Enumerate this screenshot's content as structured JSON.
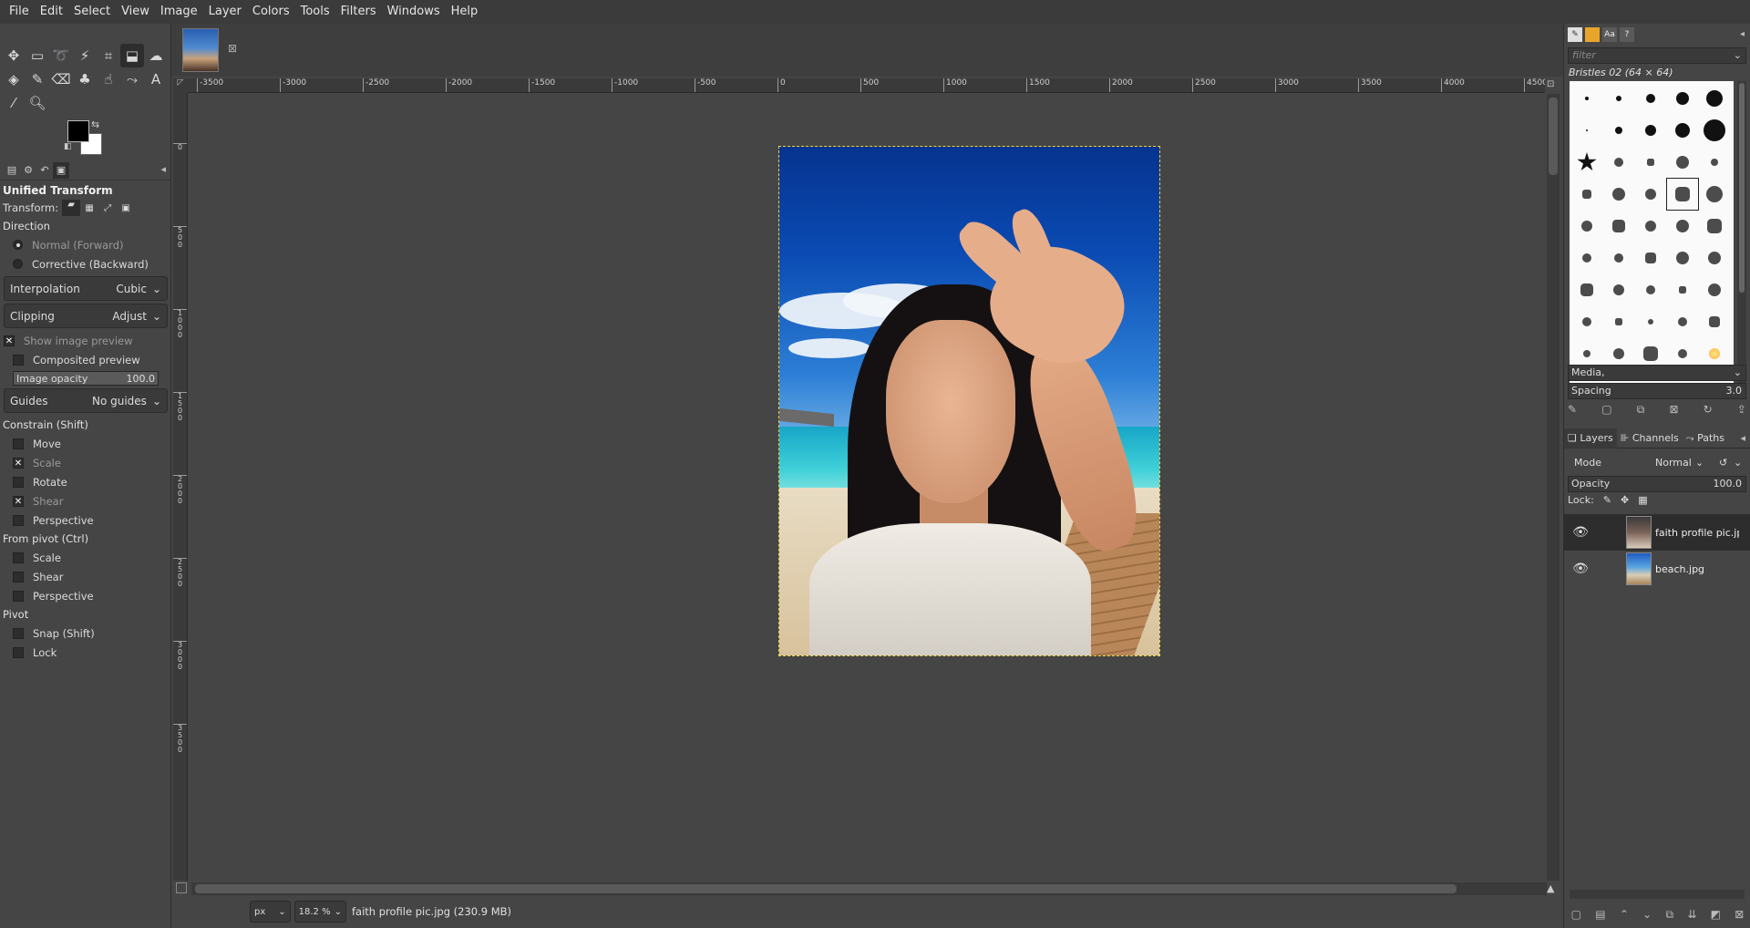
{
  "menubar": {
    "items": [
      "File",
      "Edit",
      "Select",
      "View",
      "Image",
      "Layer",
      "Colors",
      "Tools",
      "Filters",
      "Windows",
      "Help"
    ]
  },
  "tool_options": {
    "title": "Unified Transform",
    "transform_label": "Transform:",
    "direction_label": "Direction",
    "direction_forward": "Normal (Forward)",
    "direction_backward": "Corrective (Backward)",
    "interpolation_label": "Interpolation",
    "interpolation_value": "Cubic",
    "clipping_label": "Clipping",
    "clipping_value": "Adjust",
    "show_preview": "Show image preview",
    "composited_preview": "Composited preview",
    "opacity_label": "Image opacity",
    "opacity_value": "100.0",
    "guides_label": "Guides",
    "guides_value": "No guides",
    "constrain_label": "Constrain (Shift)",
    "constrain_move": "Move",
    "constrain_scale": "Scale",
    "constrain_rotate": "Rotate",
    "constrain_shear": "Shear",
    "constrain_perspective": "Perspective",
    "pivot_label": "From pivot  (Ctrl)",
    "pivot_scale": "Scale",
    "pivot_shear": "Shear",
    "pivot_perspective": "Perspective",
    "pivot_section": "Pivot",
    "snap": "Snap (Shift)",
    "lock": "Lock"
  },
  "rulers": {
    "h_labels": [
      "-3500",
      "-3000",
      "-2500",
      "-2000",
      "-1500",
      "-1000",
      "-500",
      "0",
      "500",
      "1000",
      "1500",
      "2000",
      "2500",
      "3000",
      "3500",
      "4000",
      "4500"
    ],
    "v_labels": [
      "0",
      "500",
      "1000",
      "1500",
      "2000",
      "2500",
      "3000",
      "3500"
    ]
  },
  "brushes": {
    "filter_placeholder": "filter",
    "selected_brush": "Bristles 02 (64 × 64)",
    "tag": "Media,",
    "spacing_label": "Spacing",
    "spacing_value": "3.0"
  },
  "layers": {
    "tab_layers": "Layers",
    "tab_channels": "Channels",
    "tab_paths": "Paths",
    "mode_label": "Mode",
    "mode_value": "Normal",
    "opacity_label": "Opacity",
    "opacity_value": "100.0",
    "lock_label": "Lock:",
    "items": [
      {
        "name": "faith profile pic.jpg"
      },
      {
        "name": "beach.jpg"
      }
    ]
  },
  "statusbar": {
    "unit": "px",
    "zoom": "18.2 %",
    "message": "faith profile pic.jpg (230.9 MB)"
  },
  "colors": {
    "fg": "#000000",
    "bg": "#ffffff",
    "selection_border": "#e8d24a"
  }
}
